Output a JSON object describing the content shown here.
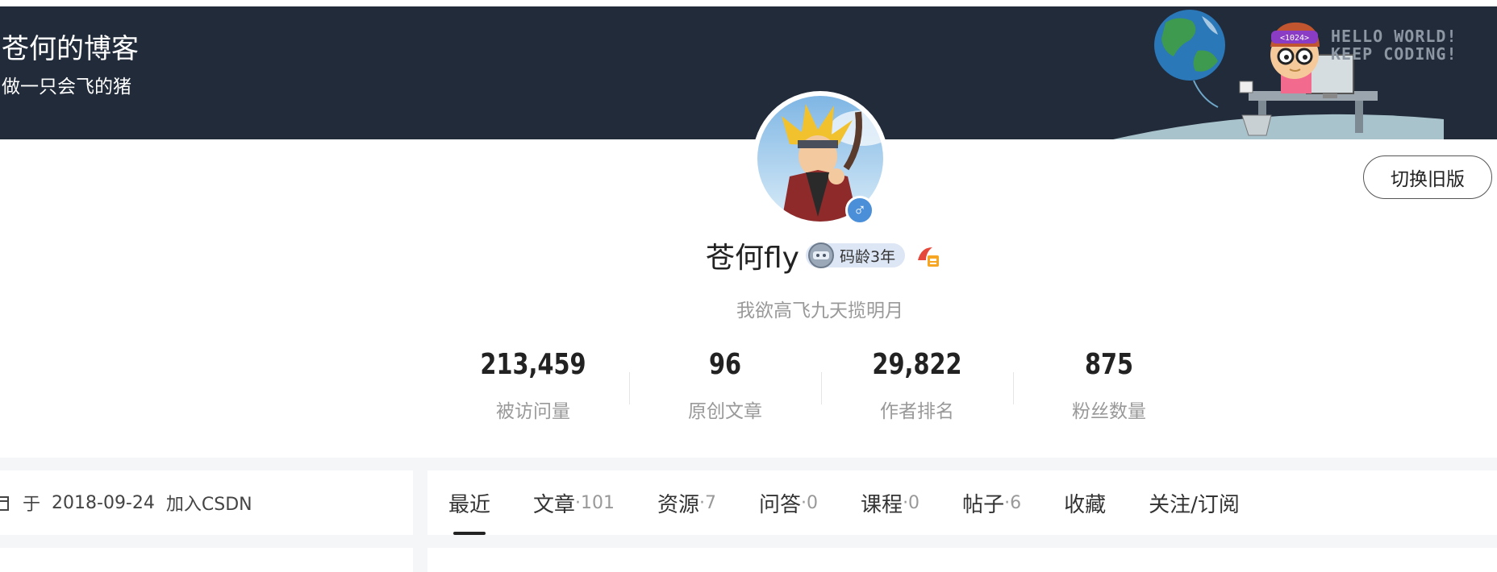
{
  "banner": {
    "title": "苍何的博客",
    "subtitle": "做一只会飞的猪",
    "hello_line1": "HELLO WORLD!",
    "hello_line2": "KEEP CODING!",
    "badge_text": "<1024>"
  },
  "header": {
    "switch_label": "切换旧版"
  },
  "profile": {
    "username": "苍何fly",
    "age_badge": "码龄3年",
    "gender_symbol": "♂",
    "bio": "我欲高飞九天揽明月"
  },
  "stats": [
    {
      "value": "213,459",
      "label": "被访问量"
    },
    {
      "value": "96",
      "label": "原创文章"
    },
    {
      "value": "29,822",
      "label": "作者排名"
    },
    {
      "value": "875",
      "label": "粉丝数量"
    }
  ],
  "left": {
    "join_prefix": "于",
    "join_date": "2018-09-24",
    "join_suffix": "加入CSDN"
  },
  "tabs": [
    {
      "label": "最近",
      "count": ""
    },
    {
      "label": "文章",
      "count": "·101"
    },
    {
      "label": "资源",
      "count": "·7"
    },
    {
      "label": "问答",
      "count": "·0"
    },
    {
      "label": "课程",
      "count": "·0"
    },
    {
      "label": "帖子",
      "count": "·6"
    },
    {
      "label": "收藏",
      "count": ""
    },
    {
      "label": "关注/订阅",
      "count": ""
    }
  ],
  "colors": {
    "banner_bg": "#212b3a",
    "gender_badge": "#4a8fd8",
    "age_badge_bg": "#dde6f5"
  }
}
